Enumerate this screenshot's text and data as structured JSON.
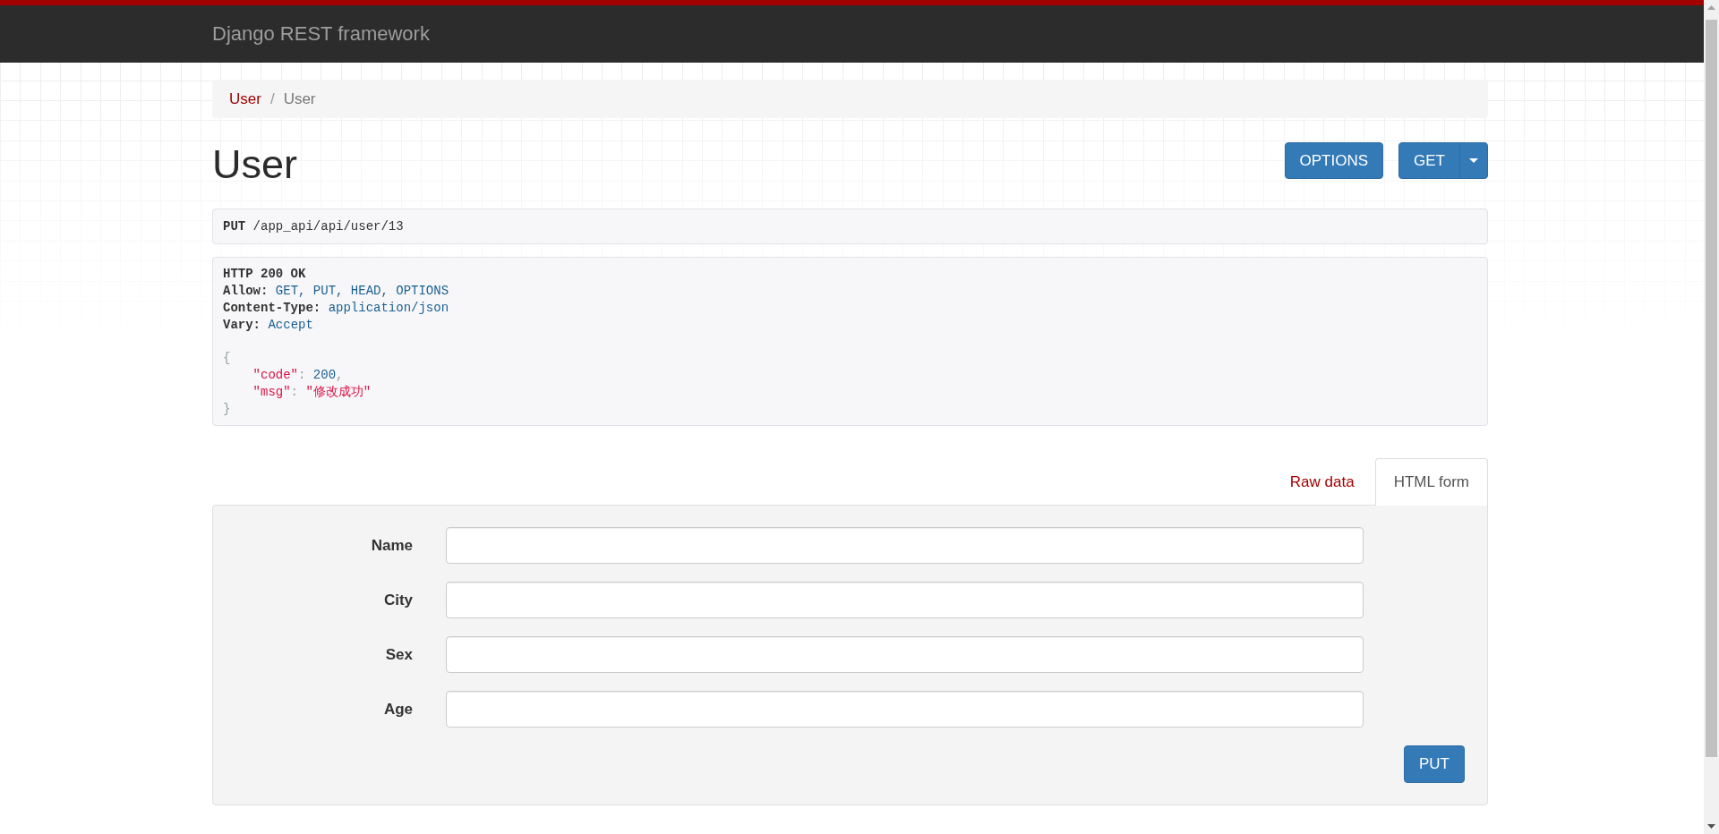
{
  "navbar": {
    "brand": "Django REST framework"
  },
  "breadcrumb": {
    "separator": "/",
    "items": [
      {
        "label": "User",
        "current": false
      },
      {
        "label": "User",
        "current": true
      }
    ]
  },
  "page": {
    "title": "User",
    "buttons": [
      {
        "label": "OPTIONS",
        "kind": "single"
      },
      {
        "label": "GET",
        "kind": "split"
      }
    ]
  },
  "request": {
    "line": "**PUT** /app_api/api/user/13"
  },
  "response": {
    "status": "HTTP 200 OK",
    "headers": [
      {
        "name": "Allow:",
        "value": "GET, PUT, HEAD, OPTIONS"
      },
      {
        "name": "Content-Type:",
        "value": "application/json"
      },
      {
        "name": "Vary:",
        "value": "Accept"
      }
    ],
    "body": {
      "open": "{",
      "members": [
        {
          "tokens": [
            {
              "text": "\"code\"",
              "kind": "key"
            },
            {
              "text": ": ",
              "kind": "punct"
            },
            {
              "text": "200",
              "kind": "number"
            },
            {
              "text": ",",
              "kind": "punct"
            }
          ]
        },
        {
          "tokens": [
            {
              "text": "\"msg\"",
              "kind": "key"
            },
            {
              "text": ": ",
              "kind": "punct"
            },
            {
              "text": "\"修改成功\"",
              "kind": "string"
            }
          ]
        }
      ],
      "close": "}"
    }
  },
  "form_tabs": [
    {
      "label": "Raw data",
      "selected": false
    },
    {
      "label": "HTML form",
      "selected": true
    }
  ],
  "form": {
    "fields": [
      {
        "label": "Name"
      },
      {
        "label": "City"
      },
      {
        "label": "Sex"
      },
      {
        "label": "Age"
      }
    ],
    "submit": "PUT"
  }
}
